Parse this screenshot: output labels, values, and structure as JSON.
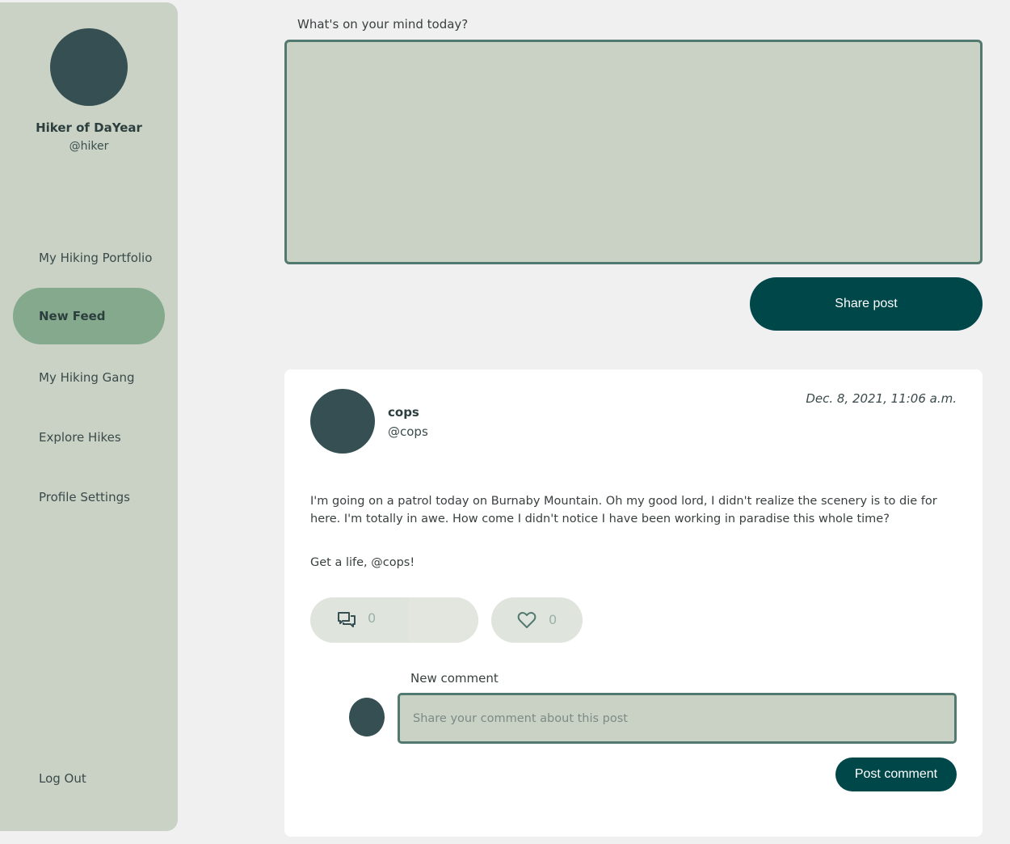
{
  "user": {
    "name": "Hiker of DaYear",
    "handle": "@hiker"
  },
  "nav": {
    "items": [
      {
        "label": "My Hiking Portfolio",
        "active": false
      },
      {
        "label": "New Feed",
        "active": true
      },
      {
        "label": "My Hiking Gang",
        "active": false
      },
      {
        "label": "Explore Hikes",
        "active": false
      },
      {
        "label": "Profile Settings",
        "active": false
      }
    ],
    "logout": "Log Out"
  },
  "composer": {
    "label": "What's on your mind today?",
    "value": "",
    "share_label": "Share post"
  },
  "post": {
    "author": "cops",
    "handle": "@cops",
    "date": "Dec. 8, 2021, 11:06 a.m.",
    "paragraphs": [
      "I'm going on a patrol today on Burnaby Mountain. Oh my good lord, I didn't realize the scenery is to die for here. I'm totally in awe. How come I didn't notice I have been working in paradise this whole time?",
      "Get a life, @cops!"
    ],
    "comment_count": "0",
    "like_count": "0",
    "comment_icon": "comment-icon",
    "like_icon": "heart-icon"
  },
  "comment": {
    "label": "New comment",
    "placeholder": "Share your comment about this post",
    "submit_label": "Post comment"
  },
  "colors": {
    "sidebar_bg": "#cad2c5",
    "nav_active": "#84a98c",
    "avatar": "#354f52",
    "primary_button": "#00474a",
    "field_border": "#52796f"
  }
}
